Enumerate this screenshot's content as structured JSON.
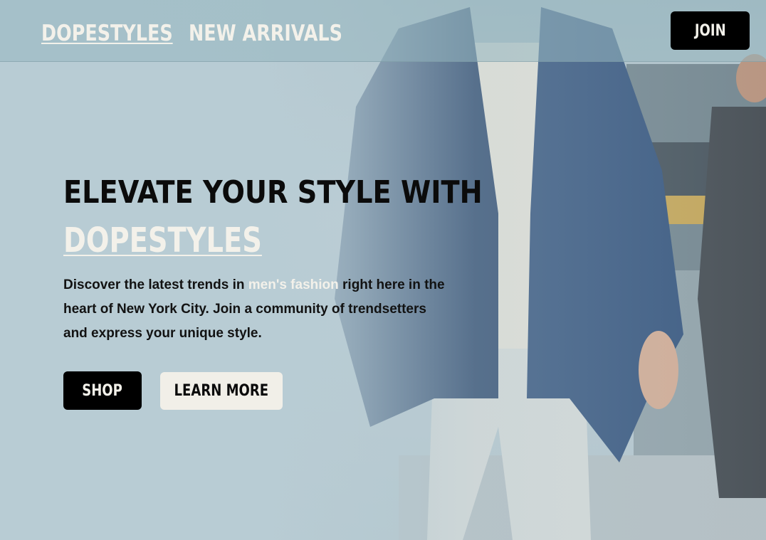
{
  "nav": {
    "brand_link": "DOPESTYLES",
    "new_arrivals_link": "NEW ARRIVALS",
    "join_label": "JOIN"
  },
  "hero": {
    "headline": "ELEVATE YOUR STYLE WITH",
    "brand": "DOPESTYLES",
    "description_before": "Discover the latest trends in ",
    "description_highlight": "men's fashion",
    "description_after": " right here in the heart of New York City. Join a community of trendsetters and express your unique style.",
    "shop_label": "SHOP",
    "learn_more_label": "LEARN MORE"
  },
  "colors": {
    "overlay": "#b8ccd4",
    "cream": "#f3f1ea",
    "black": "#000000",
    "jacket_blue": "#1f3f68"
  }
}
